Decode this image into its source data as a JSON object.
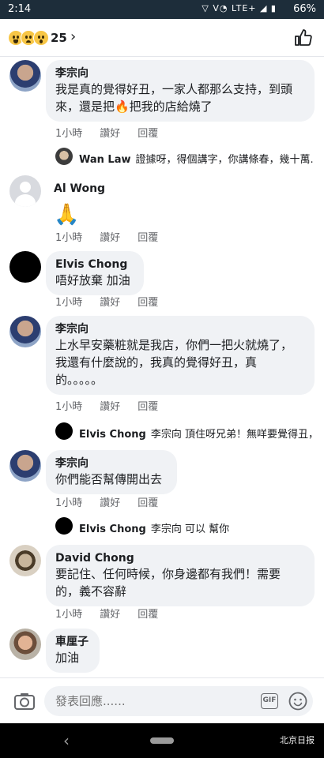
{
  "status_bar": {
    "time": "2:14",
    "signal": "LTE+",
    "battery": "66%"
  },
  "header": {
    "reaction_count": "25"
  },
  "comments": [
    {
      "name": "李宗向",
      "lines": [
        "我是真的覺得好丑，一家人都那么支持，到頭",
        "來，還是把🔥把我的店給燒了"
      ],
      "time": "1小時",
      "like": "讚好",
      "reply": "回覆"
    },
    {
      "name": "Al Wong",
      "lines": [
        "🙏"
      ],
      "time": "1小時",
      "like": "讚好",
      "reply": "回覆"
    },
    {
      "name": "Elvis Chong",
      "lines": [
        "唔好放棄 加油"
      ],
      "time": "1小時",
      "like": "讚好",
      "reply": "回覆"
    },
    {
      "name": "李宗向",
      "lines": [
        "上水早安藥粧就是我店，你們一把火就燒了，",
        "我還有什麼說的，我真的覺得好丑，真",
        "的。。。。。"
      ],
      "time": "1小時",
      "like": "讚好",
      "reply": "回覆"
    },
    {
      "name": "李宗向",
      "lines": [
        "你們能否幫傳開出去"
      ],
      "time": "1小時",
      "like": "讚好",
      "reply": "回覆"
    },
    {
      "name": "David  Chong",
      "lines": [
        "要記住、任何時候，你身邊都有我們！需要",
        "的，義不容辭"
      ],
      "time": "1小時",
      "like": "讚好",
      "reply": "回覆"
    },
    {
      "name": "車厘子",
      "lines": [
        "加油"
      ]
    }
  ],
  "replies": [
    {
      "name": "Wan Law",
      "text": "證據呀，得個講字，你講條春，幾十萬..."
    },
    {
      "name": "Elvis Chong",
      "text": "李宗向 頂住呀兄弟！無咩要覺得丑，..."
    },
    {
      "name": "Elvis Chong",
      "text": "李宗向 可以 幫你"
    }
  ],
  "input": {
    "placeholder": "發表回應......"
  },
  "watermark": "北京日报"
}
